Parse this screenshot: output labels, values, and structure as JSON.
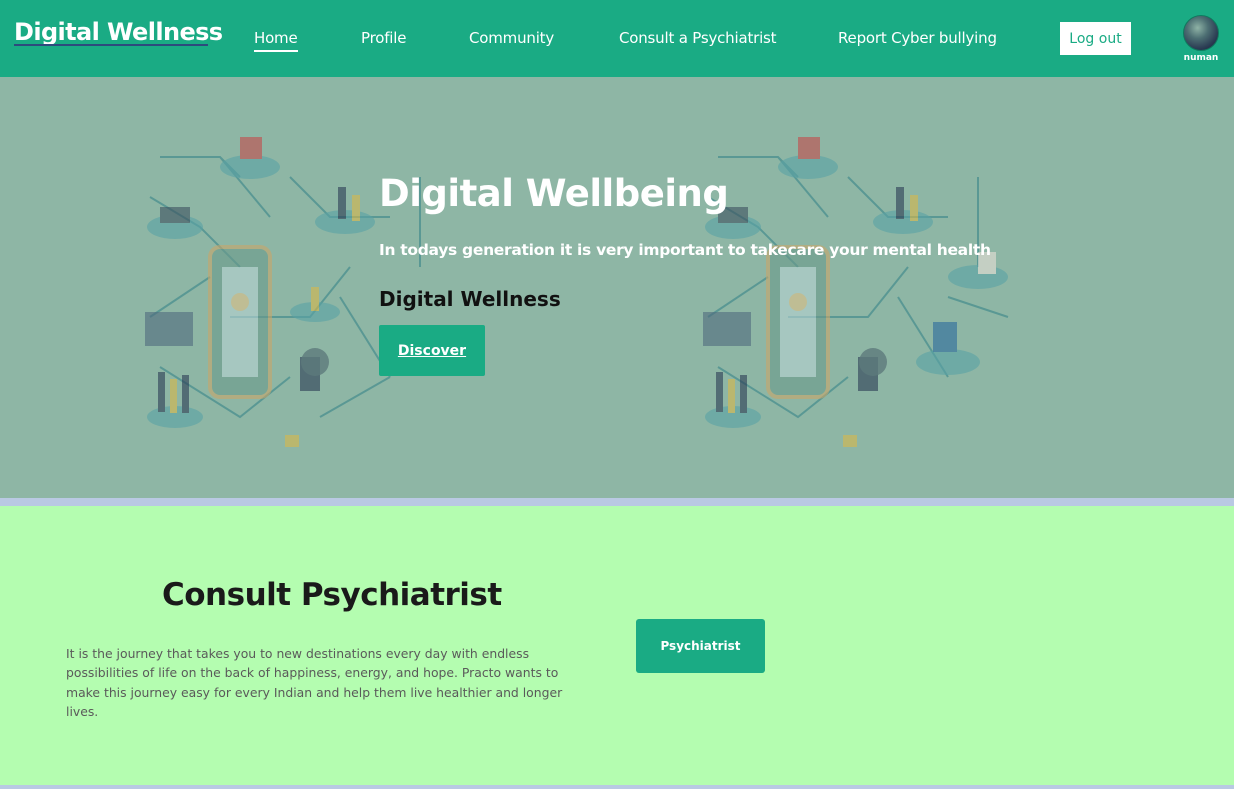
{
  "navbar": {
    "brand": "Digital Wellness",
    "links": [
      {
        "label": "Home",
        "active": true
      },
      {
        "label": "Profile",
        "active": false
      },
      {
        "label": "Community",
        "active": false
      },
      {
        "label": "Consult a Psychiatrist",
        "active": false
      },
      {
        "label": "Report Cyber bullying",
        "active": false
      }
    ],
    "logout_label": "Log out",
    "user_name": "numan"
  },
  "hero": {
    "title": "Digital Wellbeing",
    "subtitle": "In todays generation it is very important to takecare your mental health",
    "heading": "Digital Wellness",
    "button_label": "Discover",
    "illustration_icon": "healthcare-network-illustration"
  },
  "consult": {
    "title": "Consult Psychiatrist",
    "description": "It is the journey that takes you to new destinations every day with endless possibilities of life on the back of happiness, energy, and hope. Practo wants to make this journey easy for every Indian and help them live healthier and longer lives.",
    "button_label": "Psychiatrist"
  },
  "colors": {
    "primary": "#1aab84",
    "hero_overlay": "#8eb6a5",
    "consult_bg": "#b4fdb0",
    "band": "#b9c9e3"
  }
}
